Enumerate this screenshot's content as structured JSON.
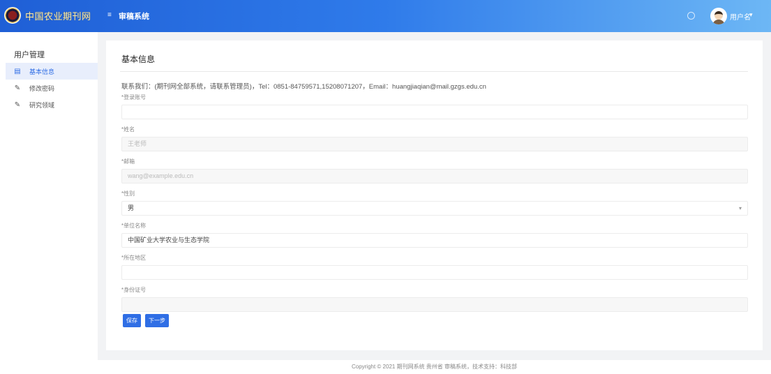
{
  "header": {
    "logo_text": "中国农业期刊网",
    "menu_toggle": "≡",
    "tab": "审稿系统",
    "username": "用户名",
    "caret": "▾"
  },
  "sidebar": {
    "title": "用户管理",
    "items": [
      {
        "label": "基本信息",
        "icon": "user-card-icon",
        "glyph": "▤"
      },
      {
        "label": "修改密码",
        "icon": "edit-icon",
        "glyph": "✎"
      },
      {
        "label": "研究领域",
        "icon": "edit-icon",
        "glyph": "✎"
      }
    ]
  },
  "card": {
    "title": "基本信息",
    "tip": "联系我们：(期刊网全部系统，请联系管理员)，Tel：0851-84759571,15208071207，Email：huangjiaqian@mail.gzgs.edu.cn"
  },
  "fields": [
    {
      "label": "*登录账号",
      "value": "",
      "disabled": false
    },
    {
      "label": "*姓名",
      "value": "王老师",
      "disabled": true
    },
    {
      "label": "*邮箱",
      "value": "wang@example.edu.cn",
      "disabled": true
    },
    {
      "label": "*性别",
      "value": "男",
      "disabled": false,
      "select": true
    },
    {
      "label": "*单位名称",
      "value": "中国矿业大学农业与生态学院",
      "disabled": false
    },
    {
      "label": "*所在地区",
      "value": "",
      "disabled": false
    },
    {
      "label": "*身份证号",
      "value": "",
      "disabled": true
    }
  ],
  "buttons": {
    "save": "保存",
    "next": "下一步"
  },
  "footer": {
    "text": "Copyright © 2021 期刊网系统 贵州省 审稿系统，技术支持：科技部"
  },
  "colors": {
    "primary": "#2f6ee5",
    "header_start": "#1f5fd6",
    "header_end": "#6db7f5"
  }
}
